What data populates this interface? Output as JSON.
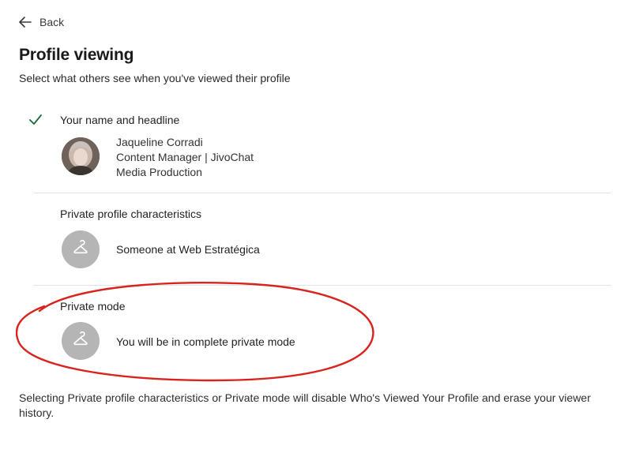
{
  "nav": {
    "back_label": "Back"
  },
  "page": {
    "title": "Profile viewing",
    "subtitle": "Select what others see when you've viewed their profile"
  },
  "options": [
    {
      "label": "Your name and headline",
      "selected": true,
      "profile": {
        "name": "Jaqueline Corradi",
        "headline": "Content Manager | JivoChat",
        "industry": "Media Production"
      }
    },
    {
      "label": "Private profile characteristics",
      "selected": false,
      "text": "Someone at Web Estratégica"
    },
    {
      "label": "Private mode",
      "selected": false,
      "text": "You will be in complete private mode"
    }
  ],
  "footer": {
    "note": "Selecting Private profile characteristics or Private mode will disable Who's Viewed Your Profile and erase your viewer history."
  },
  "colors": {
    "check": "#1a6b3c",
    "highlight_ring": "#d8231e",
    "avatar_placeholder": "#b5b5b5",
    "divider": "#e4e4e4"
  },
  "icons": {
    "back": "arrow-left-icon",
    "selected": "checkmark-icon",
    "placeholder": "hanger-icon"
  }
}
